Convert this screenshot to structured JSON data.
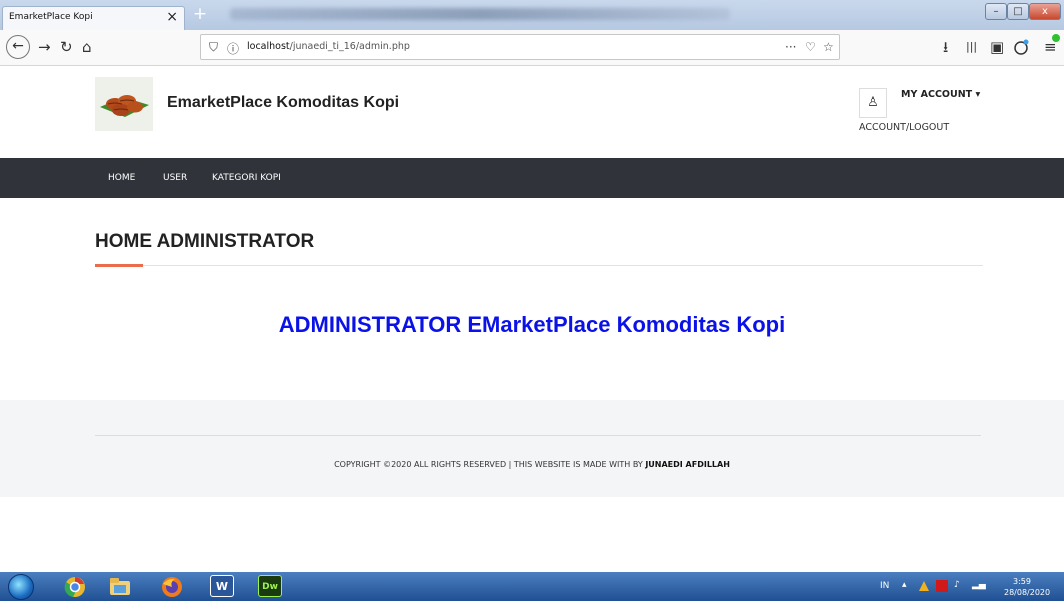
{
  "browser": {
    "tab_title": "EmarketPlace Kopi",
    "tab_close": "×",
    "new_tab": "+",
    "url_host": "localhost",
    "url_path": "/junaedi_ti_16/admin.php",
    "url_more": "···",
    "win_min": "–",
    "win_max": "□",
    "win_close": "x"
  },
  "icons": {
    "back": "←",
    "forward": "→",
    "reload": "↻",
    "home": "⌂",
    "shield": "⛉",
    "info": "ⓘ",
    "pocket": "♡",
    "bookmark": "☆",
    "download": "⭳",
    "library": "|||",
    "sidebar": "▣",
    "menu": "≡",
    "user": "♙"
  },
  "site": {
    "title": "EmarketPlace Komoditas Kopi",
    "account_title": "MY ACCOUNT ▾",
    "account_sub": "ACCOUNT/LOGOUT"
  },
  "nav": {
    "home": "HOME",
    "user": "USER",
    "kategori": "KATEGORI KOPI"
  },
  "main": {
    "heading": "HOME ADMINISTRATOR",
    "banner": "ADMINISTRATOR EMarketPlace Komoditas Kopi"
  },
  "footer": {
    "text": "COPYRIGHT ©2020 ALL RIGHTS RESERVED | THIS WEBSITE IS MADE WITH BY",
    "author": "JUNAEDI AFDILLAH"
  },
  "taskbar": {
    "word": "W",
    "dw": "Dw",
    "lang": "IN",
    "time": "3:59",
    "date": "28/08/2020"
  },
  "colors": {
    "nav_bg": "#30343a",
    "accent": "#ee6a4d",
    "banner": "#0a12e8"
  }
}
